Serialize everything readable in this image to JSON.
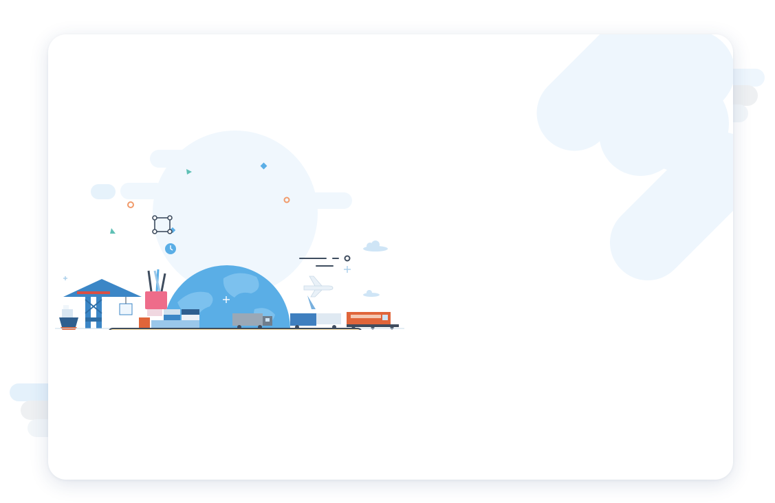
{
  "colors": {
    "card_background": "#ffffff",
    "decor_light_blue": "#eef6fd",
    "globe_blue": "#5aaee6",
    "crane_blue": "#3b86c6",
    "desk_wood": "#f5d99a",
    "pencil_cup_pink": "#ee6c8a",
    "train_orange": "#e0653a",
    "accent_orange_ring": "#f19a6a"
  },
  "illustration": {
    "subject": "global-logistics-desk",
    "icons": [
      "crane-icon",
      "ship-icon",
      "globe-icon",
      "pencil-cup-icon",
      "truck-icon",
      "train-icon",
      "airplane-icon",
      "cloud-icon",
      "transform-frame-icon",
      "clock-icon"
    ]
  }
}
